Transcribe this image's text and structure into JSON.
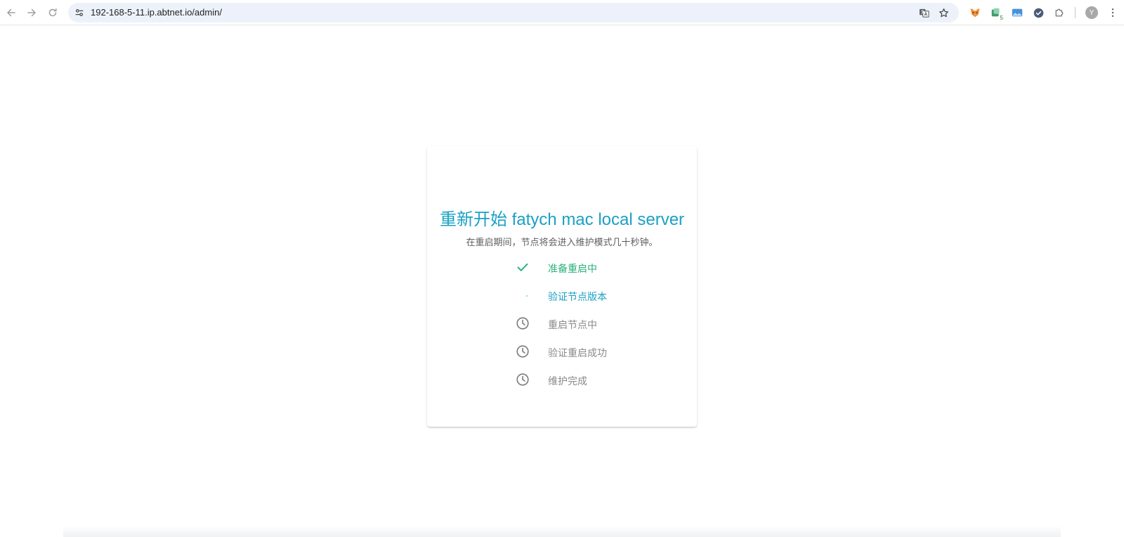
{
  "browser": {
    "url": "192-168-5-11.ip.abtnet.io/admin/",
    "profile_initial": "Y",
    "extensions": [
      {
        "name": "metamask-fox-icon",
        "badge": ""
      },
      {
        "name": "wallet-extension-icon",
        "badge": "5"
      },
      {
        "name": "image-extension-icon",
        "badge": ""
      },
      {
        "name": "check-circle-extension-icon",
        "badge": ""
      },
      {
        "name": "puzzle-extensions-icon",
        "badge": ""
      }
    ]
  },
  "card": {
    "title": "重新开始 fatych mac local server",
    "subtitle": "在重启期间，节点将会进入维护模式几十秒钟。",
    "steps": [
      {
        "label": "准备重启中",
        "status": "done"
      },
      {
        "label": "验证节点版本",
        "status": "active"
      },
      {
        "label": "重启节点中",
        "status": "pending"
      },
      {
        "label": "验证重启成功",
        "status": "pending"
      },
      {
        "label": "维护完成",
        "status": "pending"
      }
    ]
  },
  "colors": {
    "accent": "#1ba0c4",
    "success": "#2ab27b",
    "pending": "#8a8a8a",
    "omnibox_bg": "#edf2fa"
  }
}
